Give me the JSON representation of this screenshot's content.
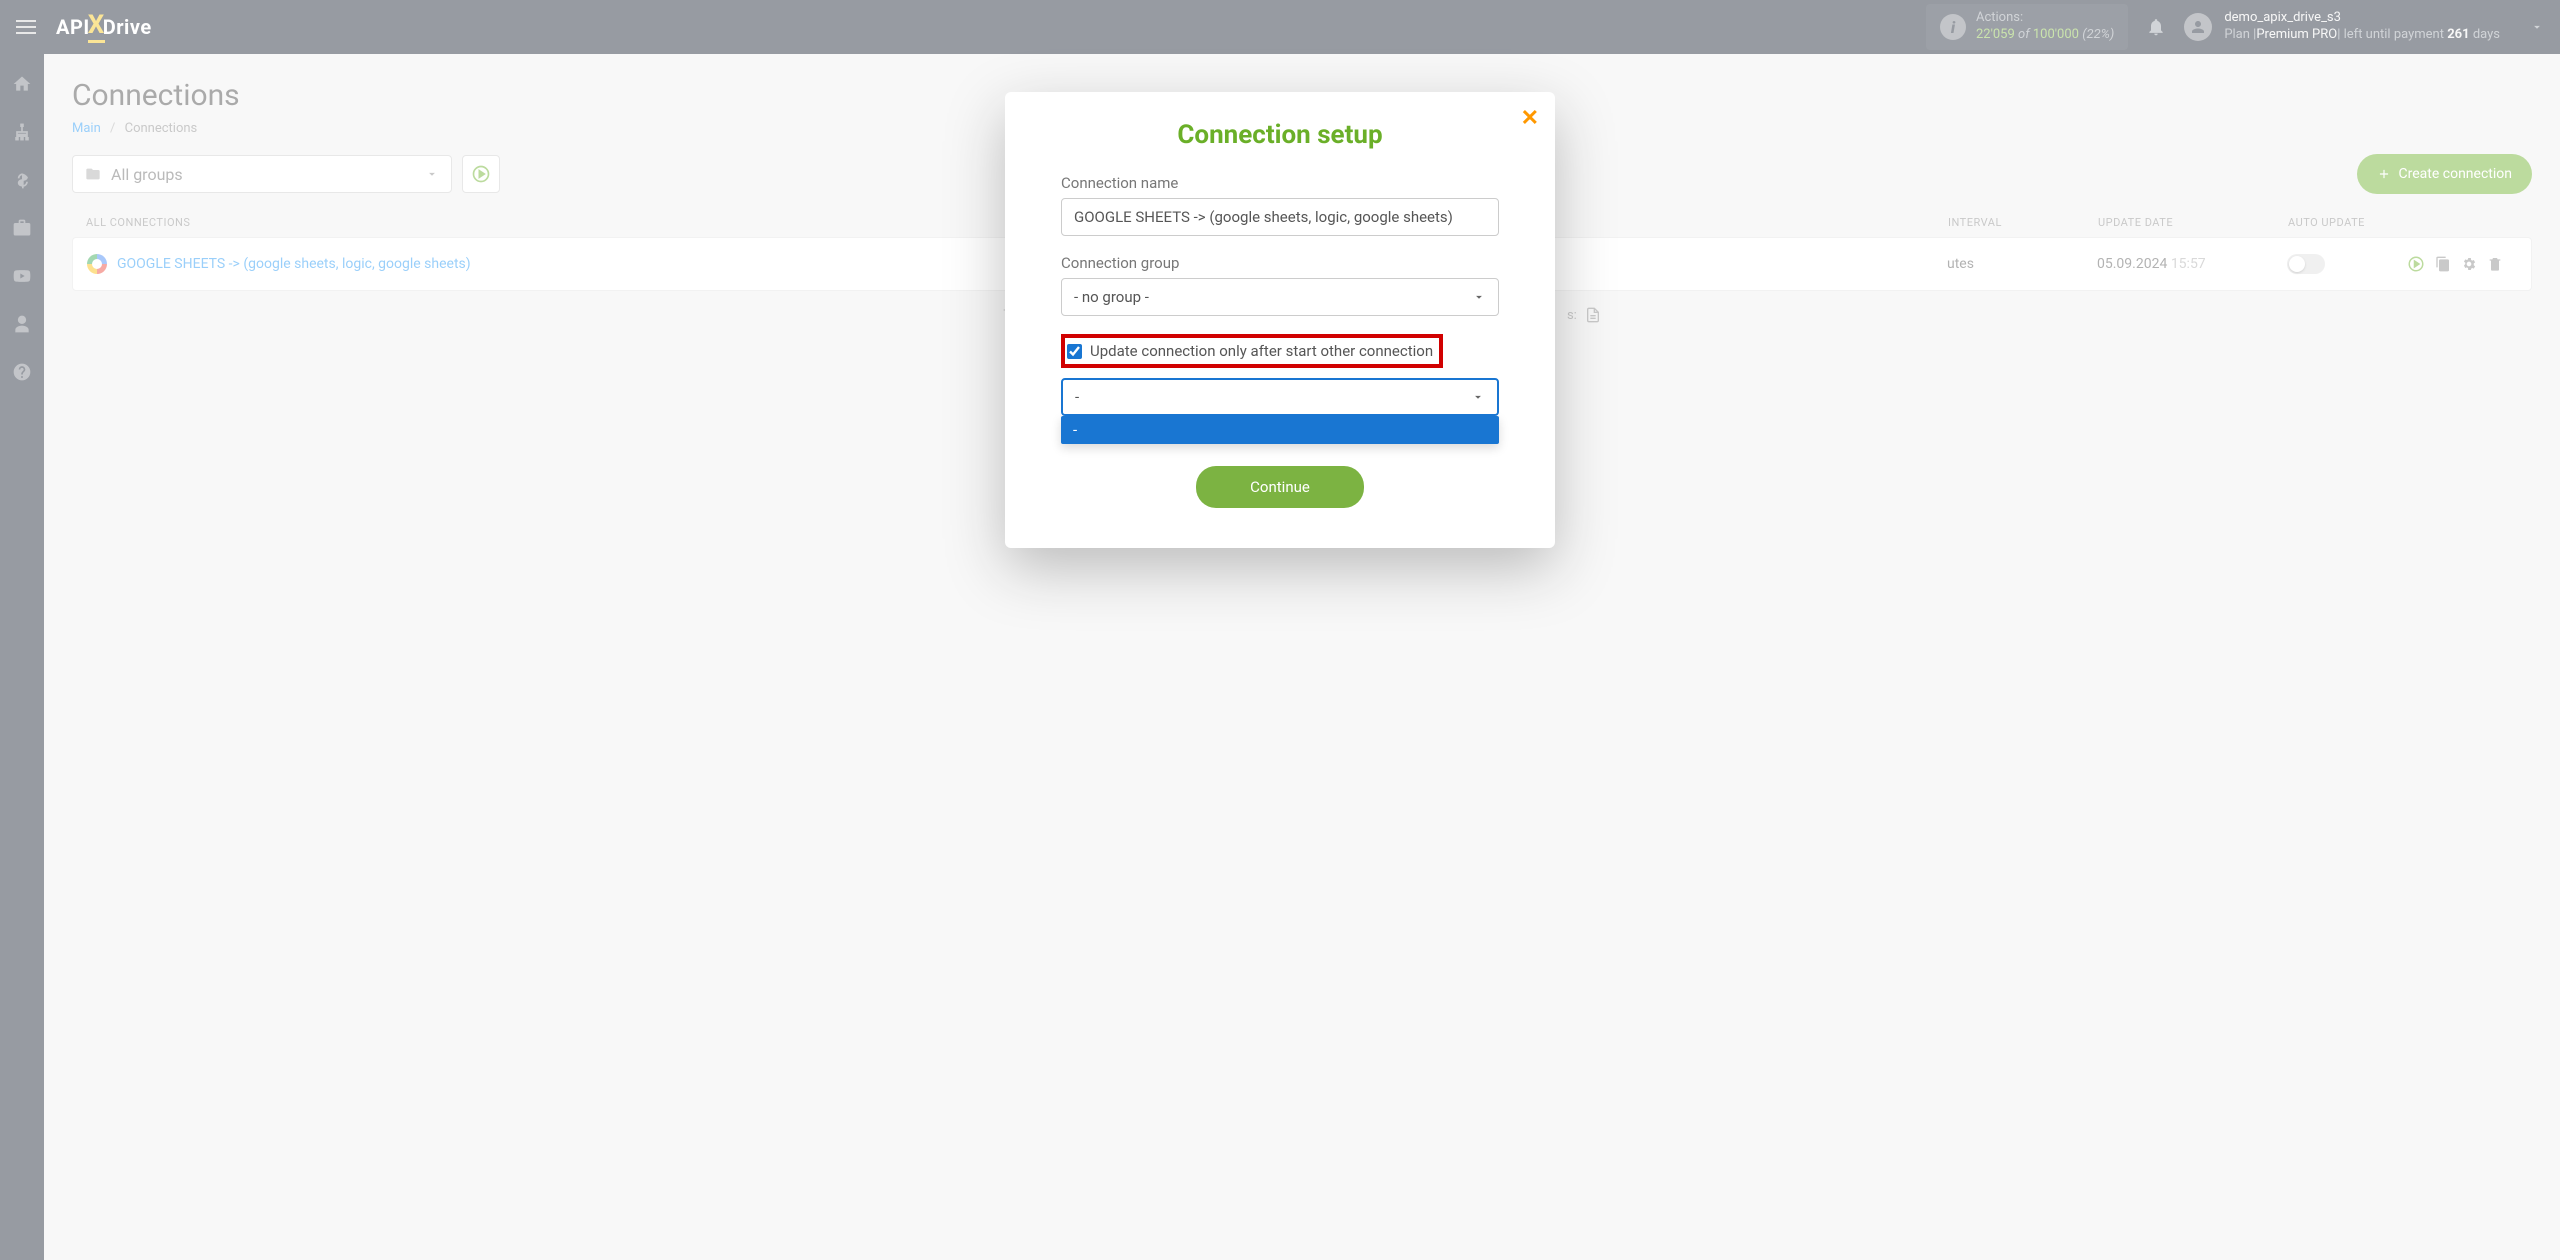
{
  "header": {
    "logo_left": "API",
    "logo_x": "X",
    "logo_right": "Drive",
    "actions_label": "Actions:",
    "actions_used": "22'059",
    "actions_of": "of",
    "actions_total": "100'000",
    "actions_pct": "(22%)",
    "username": "demo_apix_drive_s3",
    "plan_prefix": "Plan |",
    "plan_name": "Premium PRO",
    "plan_suffix": "| left until payment ",
    "plan_days_num": "261",
    "plan_days_word": " days"
  },
  "page": {
    "title": "Connections",
    "bc_main": "Main",
    "bc_current": "Connections"
  },
  "toolbar": {
    "group_selected": "All groups",
    "create_label": "Create connection"
  },
  "table": {
    "head_name": "ALL CONNECTIONS",
    "head_interval": "INTERVAL",
    "head_update": "UPDATE DATE",
    "head_auto": "AUTO UPDATE"
  },
  "row": {
    "name_a": "GOOGLE SHEETS ->",
    "name_b": " (google sheets, logic, google sheets)",
    "interval": "utes",
    "update_date": "05.09.2024",
    "update_time": "15:57"
  },
  "footer": {
    "text_left": "T",
    "text_right": "s:"
  },
  "modal": {
    "title": "Connection setup",
    "name_label": "Connection name",
    "name_value": "GOOGLE SHEETS -> (google sheets, logic, google sheets)",
    "group_label": "Connection group",
    "group_value": "- no group -",
    "checkbox_label": "Update connection only after start other connection",
    "dep_selected": "-",
    "dep_option": "-",
    "continue": "Continue"
  }
}
